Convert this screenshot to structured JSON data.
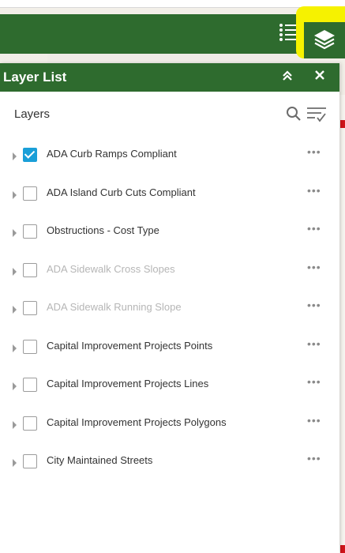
{
  "header": {
    "title": "Layer List",
    "collapse_icon": "double-chevron-up-icon",
    "close_icon": "close-icon"
  },
  "toolbar": {
    "legend_icon": "list-icon",
    "layers_icon": "layers-icon"
  },
  "section": {
    "label": "Layers",
    "search_icon": "search-icon",
    "filter_icon": "filter-icon"
  },
  "layers": [
    {
      "label": "ADA Curb Ramps Compliant",
      "checked": true,
      "dimmed": false
    },
    {
      "label": "ADA Island Curb Cuts Compliant",
      "checked": false,
      "dimmed": false
    },
    {
      "label": "Obstructions - Cost Type",
      "checked": false,
      "dimmed": false
    },
    {
      "label": "ADA Sidewalk Cross Slopes",
      "checked": false,
      "dimmed": true
    },
    {
      "label": "ADA Sidewalk Running Slope",
      "checked": false,
      "dimmed": true
    },
    {
      "label": "Capital Improvement Projects Points",
      "checked": false,
      "dimmed": false
    },
    {
      "label": "Capital Improvement Projects Lines",
      "checked": false,
      "dimmed": false
    },
    {
      "label": "Capital Improvement Projects Polygons",
      "checked": false,
      "dimmed": false
    },
    {
      "label": "City Maintained Streets",
      "checked": false,
      "dimmed": false
    }
  ],
  "more_label": "•••",
  "colors": {
    "header_green": "#2e6b2e",
    "highlight_yellow": "#f6f200",
    "checkbox_blue": "#1a9fd8"
  }
}
